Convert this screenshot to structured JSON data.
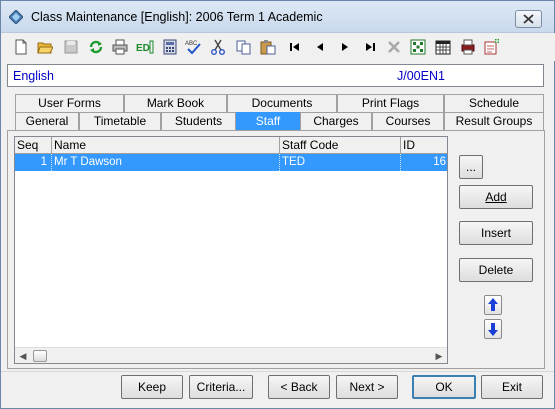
{
  "window": {
    "title": "Class Maintenance  [English]:  2006 Term 1 Academic",
    "close_label": "X"
  },
  "toolbar": {
    "icons": [
      "new-icon",
      "open-icon",
      "save-icon",
      "refresh-icon",
      "print-icon",
      "edit-id-icon",
      "calculator-icon",
      "spellcheck-icon",
      "cut-icon",
      "copy-icon",
      "paste-icon",
      "first-record-icon",
      "previous-record-icon",
      "next-record-icon",
      "last-record-icon",
      "delete-icon",
      "find-icon",
      "calendar-icon",
      "print-preview-icon",
      "edit-note-icon"
    ],
    "spell_text": "ABC",
    "ed_text": "ED"
  },
  "info_bar": {
    "subject": "English",
    "class_code": "J/00EN1"
  },
  "tabs_back": [
    {
      "label": "User Forms"
    },
    {
      "label": "Mark Book"
    },
    {
      "label": "Documents"
    },
    {
      "label": "Print Flags"
    },
    {
      "label": "Schedule"
    }
  ],
  "tabs_front": [
    {
      "label": "General"
    },
    {
      "label": "Timetable"
    },
    {
      "label": "Students"
    },
    {
      "label": "Staff",
      "active": true
    },
    {
      "label": "Charges"
    },
    {
      "label": "Courses"
    },
    {
      "label": "Result Groups"
    }
  ],
  "grid": {
    "columns": [
      "Seq",
      "Name",
      "Staff Code",
      "ID"
    ],
    "rows": [
      {
        "seq": "1",
        "name": "Mr T Dawson",
        "staff_code": "TED",
        "id": "16"
      }
    ],
    "scroll_left": "◀",
    "scroll_right": "▶"
  },
  "side_buttons": {
    "more": "...",
    "add": "Add",
    "insert": "Insert",
    "delete": "Delete"
  },
  "bottom_buttons": {
    "keep": "Keep",
    "criteria": "Criteria...",
    "back": "< Back",
    "next": "Next >",
    "ok": "OK",
    "exit": "Exit"
  },
  "colors": {
    "accent": "#3399ff",
    "info_text": "#0000c8",
    "arrow_blue": "#1a3fd6"
  }
}
